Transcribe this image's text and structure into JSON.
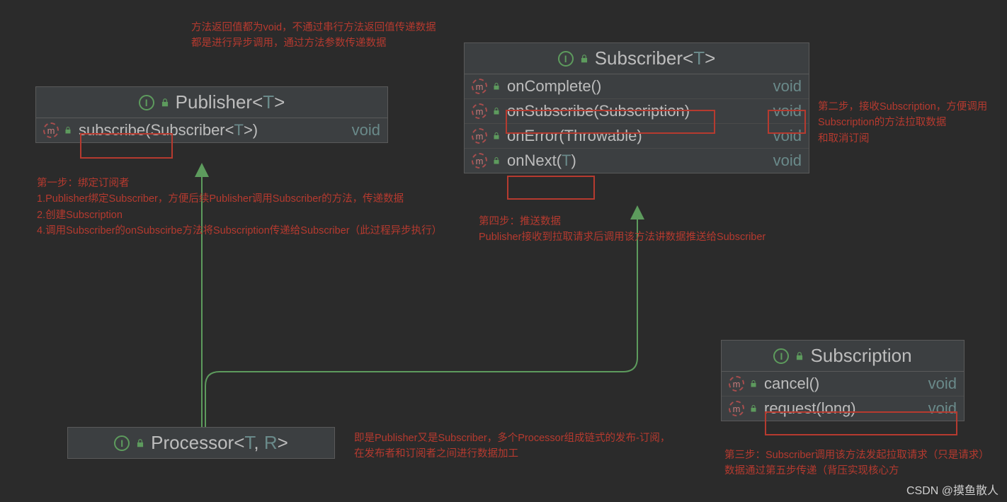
{
  "annotations": {
    "top": "方法返回值都为void，不通过串行方法返回值传递数据\n都是进行异步调用，通过方法参数传递数据",
    "step1_title": "第一步：绑定订阅者",
    "step1_line1": "1.Publisher绑定Subscriber，方便后续Publisher调用Subscriber的方法，传递数据",
    "step1_line2": "2.创建Subscription",
    "step1_line3": "4.调用Subscriber的onSubscirbe方法将Subscription传递给Subscriber（此过程异步执行）",
    "step2": "第二步，接收Subscription，方便调用\nSubscription的方法拉取数据\n和取消订阅",
    "step3": "第三步：Subscriber调用该方法发起拉取请求（只是请求）\n数据通过第五步传递（背压实现核心方",
    "step4_title": "第四步：推送数据",
    "step4_body": "Publisher接收到拉取请求后调用该方法讲数据推送给Subscriber",
    "processor_note": "即是Publisher又是Subscriber，多个Processor组成链式的发布-订阅，\n在发布者和订阅者之间进行数据加工"
  },
  "classes": {
    "publisher": {
      "name_prefix": "Publisher<",
      "generic": "T",
      "name_suffix": ">",
      "methods": [
        {
          "sig_prefix": "subscribe",
          "sig_mid": "(Subscriber<",
          "sig_generic": "T",
          "sig_suffix": ">)",
          "ret": "void"
        }
      ]
    },
    "subscriber": {
      "name_prefix": "Subscriber<",
      "generic": "T",
      "name_suffix": ">",
      "methods": [
        {
          "sig": "onComplete()",
          "ret": "void"
        },
        {
          "sig": "onSubscribe(Subscription)",
          "ret": "void"
        },
        {
          "sig": "onError(Throwable)",
          "ret": "void"
        },
        {
          "sig_prefix": "onNext(",
          "sig_generic": "T",
          "sig_suffix": ")",
          "ret": "void"
        }
      ]
    },
    "subscription": {
      "name": "Subscription",
      "methods": [
        {
          "sig": "cancel()",
          "ret": "void"
        },
        {
          "sig": "request(long)",
          "ret": "void"
        }
      ]
    },
    "processor": {
      "name_prefix": "Processor<",
      "generic1": "T",
      "sep": ", ",
      "generic2": "R",
      "name_suffix": ">"
    }
  },
  "watermark": "CSDN @摸鱼散人",
  "icon": {
    "i": "I",
    "m": "m"
  }
}
